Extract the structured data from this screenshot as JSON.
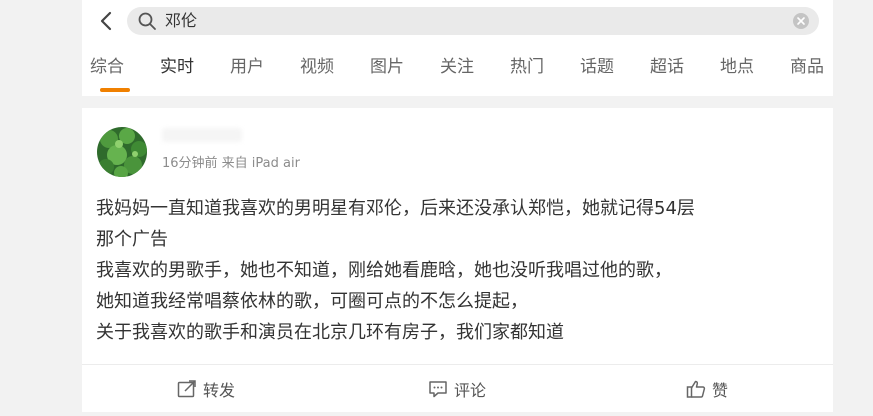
{
  "search": {
    "query": "邓伦"
  },
  "tabs": [
    {
      "label": "综合"
    },
    {
      "label": "实时",
      "active": true
    },
    {
      "label": "用户"
    },
    {
      "label": "视频"
    },
    {
      "label": "图片"
    },
    {
      "label": "关注"
    },
    {
      "label": "热门"
    },
    {
      "label": "话题"
    },
    {
      "label": "超话"
    },
    {
      "label": "地点"
    },
    {
      "label": "商品"
    }
  ],
  "post": {
    "meta": "16分钟前 来自 iPad air",
    "lines": [
      "我妈妈一直知道我喜欢的男明星有邓伦，后来还没承认郑恺，她就记得54层",
      "那个广告",
      "我喜欢的男歌手，她也不知道，刚给她看鹿晗，她也没听我唱过他的歌，",
      "她知道我经常唱蔡依林的歌，可圈可点的不怎么提起，",
      "关于我喜欢的歌手和演员在北京几环有房子，我们家都知道"
    ]
  },
  "actions": {
    "repost": "转发",
    "comment": "评论",
    "like": "赞"
  },
  "colors": {
    "accent": "#f08000",
    "background": "#f2f2f2"
  }
}
